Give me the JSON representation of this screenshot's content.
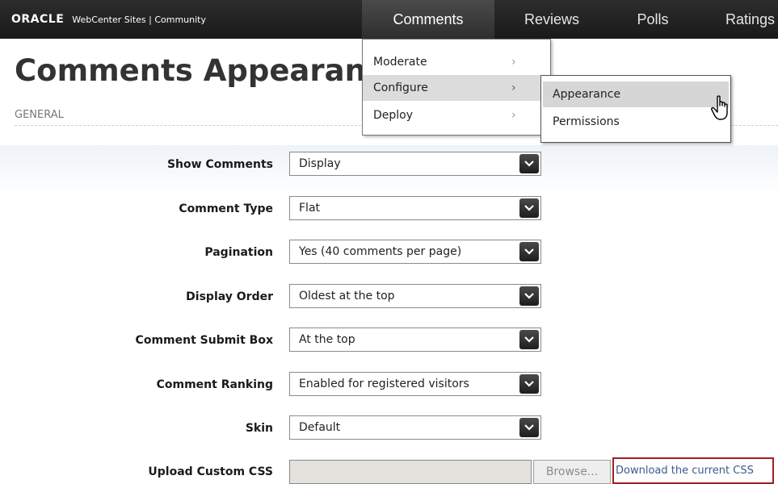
{
  "header": {
    "logo": "ORACLE",
    "app_title": "WebCenter Sites | Community",
    "tabs": [
      {
        "label": "Comments",
        "active": true
      },
      {
        "label": "Reviews",
        "active": false
      },
      {
        "label": "Polls",
        "active": false
      },
      {
        "label": "Ratings",
        "active": false
      }
    ]
  },
  "menu": {
    "items": [
      {
        "label": "Moderate"
      },
      {
        "label": "Configure"
      },
      {
        "label": "Deploy"
      }
    ],
    "submenu": [
      {
        "label": "Appearance"
      },
      {
        "label": "Permissions"
      }
    ]
  },
  "page": {
    "title": "Comments Appearance",
    "section": "GENERAL"
  },
  "form": {
    "fields": [
      {
        "label": "Show Comments",
        "value": "Display"
      },
      {
        "label": "Comment Type",
        "value": "Flat"
      },
      {
        "label": "Pagination",
        "value": "Yes (40 comments per page)"
      },
      {
        "label": "Display Order",
        "value": "Oldest at the top"
      },
      {
        "label": "Comment Submit Box",
        "value": "At the top"
      },
      {
        "label": "Comment Ranking",
        "value": "Enabled for registered visitors"
      },
      {
        "label": "Skin",
        "value": "Default"
      }
    ],
    "upload": {
      "label": "Upload Custom CSS",
      "browse": "Browse...",
      "download": "Download the current CSS"
    }
  },
  "colors": {
    "topbar": "#1a1a1a",
    "download_border": "#a31e22"
  }
}
